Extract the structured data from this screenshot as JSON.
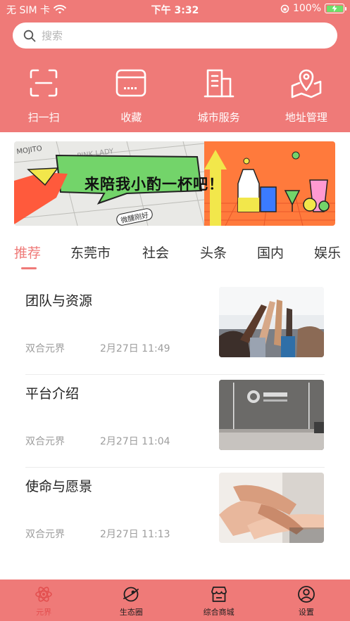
{
  "status_bar": {
    "carrier": "无 SIM 卡",
    "time": "下午 3:32",
    "battery": "100%"
  },
  "search": {
    "placeholder": "搜索"
  },
  "quick_actions": [
    {
      "label": "扫一扫",
      "icon": "scan-icon"
    },
    {
      "label": "收藏",
      "icon": "favorites-icon"
    },
    {
      "label": "城市服务",
      "icon": "building-icon"
    },
    {
      "label": "地址管理",
      "icon": "map-icon"
    }
  ],
  "banner": {
    "headline": "来陪我小酌一杯吧！",
    "tag": "微醺刚好"
  },
  "tabs": [
    "推荐",
    "东莞市",
    "社会",
    "头条",
    "国内",
    "娱乐"
  ],
  "news": [
    {
      "title": "团队与资源",
      "source": "双合元界",
      "time": "2月27日 11:49"
    },
    {
      "title": "平台介绍",
      "source": "双合元界",
      "time": "2月27日 11:04"
    },
    {
      "title": "使命与愿景",
      "source": "双合元界",
      "time": "2月27日 11:13"
    }
  ],
  "tabbar": [
    {
      "label": "元界",
      "active": true
    },
    {
      "label": "生态圈"
    },
    {
      "label": "综合商城"
    },
    {
      "label": "设置"
    }
  ],
  "colors": {
    "brand": "#ef7a78",
    "active_tab": "#e34f4f",
    "banner_green": "#73d46a",
    "banner_orange": "#ff7a3c"
  }
}
